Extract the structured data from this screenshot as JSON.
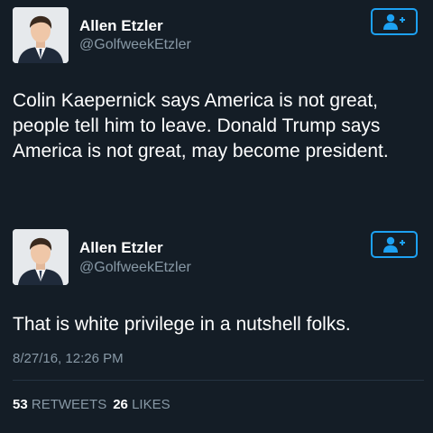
{
  "colors": {
    "background": "#141d26",
    "accent": "#1da1f2",
    "secondary_text": "#8899a6"
  },
  "tweets": [
    {
      "author_name": "Allen Etzler",
      "author_handle": "@GolfweekEtzler",
      "text": "Colin Kaepernick says America is not great, people tell him to leave. Donald Trump says America is not great, may become president.",
      "avatar_icon": "user-avatar",
      "follow_icon": "follow-user-icon"
    },
    {
      "author_name": "Allen Etzler",
      "author_handle": "@GolfweekEtzler",
      "text": "That is white privilege in a nutshell folks.",
      "avatar_icon": "user-avatar",
      "follow_icon": "follow-user-icon"
    }
  ],
  "timestamp": "8/27/16, 12:26 PM",
  "stats": {
    "retweets_count": "53",
    "retweets_label": "RETWEETS",
    "likes_count": "26",
    "likes_label": "LIKES"
  }
}
